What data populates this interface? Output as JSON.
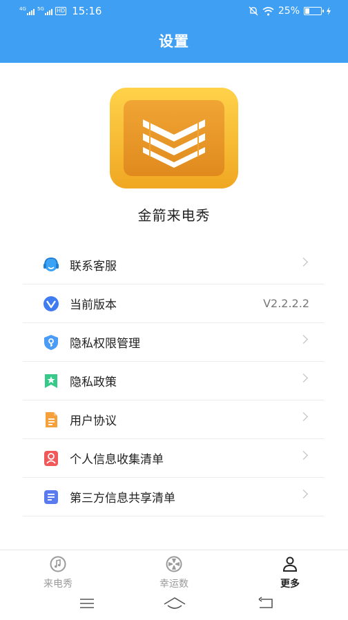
{
  "status_bar": {
    "net1": "4G",
    "net2": "5G",
    "hd": "HD",
    "time": "15:16",
    "battery": "25%"
  },
  "header": {
    "title": "设置"
  },
  "app": {
    "name": "金箭来电秀"
  },
  "menu": [
    {
      "label": "联系客服",
      "icon": "headset-icon",
      "color": "#3aa3f5"
    },
    {
      "label": "当前版本",
      "icon": "version-icon",
      "value": "V2.2.2.2",
      "color": "#3f7cf0"
    },
    {
      "label": "隐私权限管理",
      "icon": "shield-key-icon",
      "color": "#4a9cf6"
    },
    {
      "label": "隐私政策",
      "icon": "star-bookmark-icon",
      "color": "#37c98a"
    },
    {
      "label": "用户协议",
      "icon": "document-icon",
      "color": "#f5a03b"
    },
    {
      "label": "个人信息收集清单",
      "icon": "person-card-icon",
      "color": "#f0585a"
    },
    {
      "label": "第三方信息共享清单",
      "icon": "list-doc-icon",
      "color": "#5a7bf0"
    }
  ],
  "tabs": [
    {
      "label": "来电秀",
      "icon": "music-note-icon",
      "active": false
    },
    {
      "label": "幸运数",
      "icon": "wheel-icon",
      "active": false
    },
    {
      "label": "更多",
      "icon": "profile-icon",
      "active": true
    }
  ],
  "nav": [
    "menu-icon",
    "home-icon",
    "back-icon"
  ],
  "colors": {
    "header": "#3f9ff2",
    "logo_outer": "#f6b92b",
    "logo_inner": "#e89a2a"
  }
}
